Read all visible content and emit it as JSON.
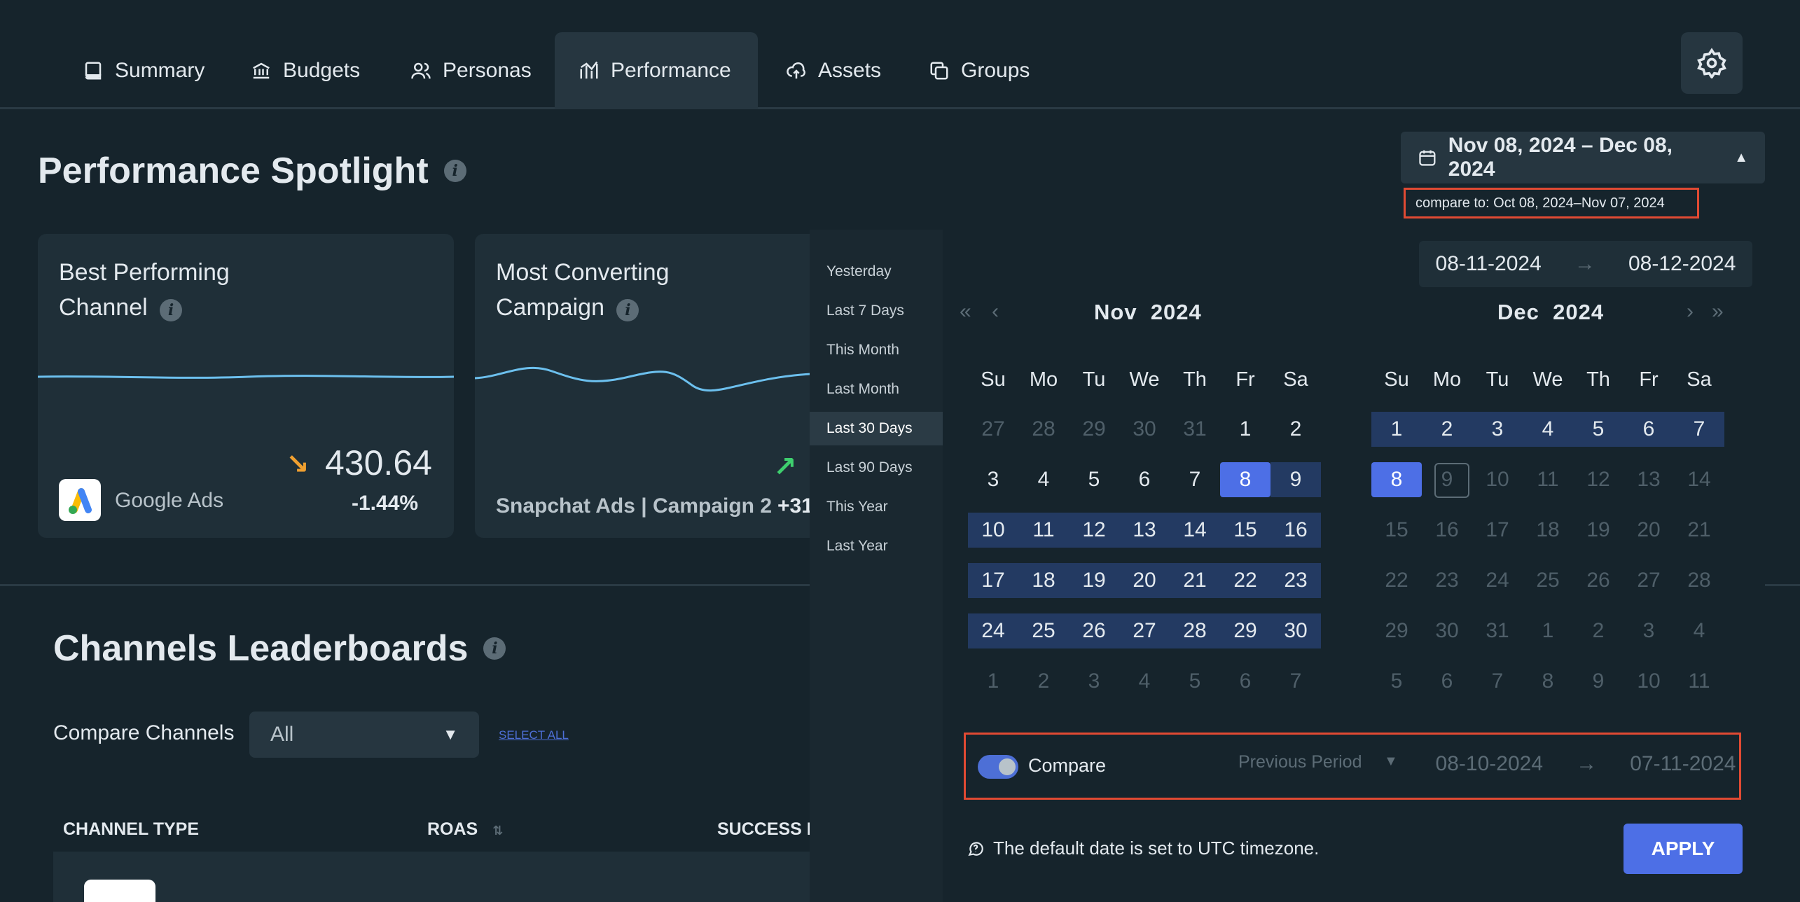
{
  "nav": {
    "tabs": [
      {
        "label": "Summary",
        "icon": "book-icon"
      },
      {
        "label": "Budgets",
        "icon": "bank-icon"
      },
      {
        "label": "Personas",
        "icon": "users-icon"
      },
      {
        "label": "Performance",
        "icon": "chart-icon"
      },
      {
        "label": "Assets",
        "icon": "cloud-upload-icon"
      },
      {
        "label": "Groups",
        "icon": "copy-icon"
      }
    ],
    "active_tab": "Performance",
    "settings_icon": "gear-icon"
  },
  "spotlight": {
    "title": "Performance Spotlight",
    "cards": [
      {
        "title_line1": "Best Performing",
        "title_line2": "Channel",
        "value": "430.64",
        "delta": "-1.44%",
        "channel": "Google Ads",
        "trend": "down"
      },
      {
        "title_line1": "Most Converting",
        "title_line2": "Campaign",
        "value": "",
        "delta": "+31",
        "channel": "Snapchat Ads | Campaign 2",
        "trend": "up"
      }
    ]
  },
  "leaderboards": {
    "title": "Channels Leaderboards",
    "compare_label": "Compare Channels",
    "select_value": "All",
    "select_all": "SELECT ALL",
    "columns": [
      "CHANNEL TYPE",
      "ROAS",
      "SUCCESS M"
    ]
  },
  "date_range": {
    "button_label": "Nov 08, 2024 – Dec 08, 2024",
    "compare_to_label": "compare to:",
    "compare_to_range": "Oct 08, 2024–Nov 07, 2024",
    "presets": [
      "Yesterday",
      "Last 7 Days",
      "This Month",
      "Last Month",
      "Last 30 Days",
      "Last 90 Days",
      "This Year",
      "Last Year"
    ],
    "active_preset": "Last 30 Days",
    "start_input": "08-11-2024",
    "end_input": "08-12-2024",
    "arrow": "→",
    "weekdays": [
      "Su",
      "Mo",
      "Tu",
      "We",
      "Th",
      "Fr",
      "Sa"
    ],
    "left_month": {
      "month": "Nov",
      "year": "2024",
      "days": [
        "27",
        "28",
        "29",
        "30",
        "31",
        "1",
        "2",
        "3",
        "4",
        "5",
        "6",
        "7",
        "8",
        "9",
        "10",
        "11",
        "12",
        "13",
        "14",
        "15",
        "16",
        "17",
        "18",
        "19",
        "20",
        "21",
        "22",
        "23",
        "24",
        "25",
        "26",
        "27",
        "28",
        "29",
        "30",
        "1",
        "2",
        "3",
        "4",
        "5",
        "6",
        "7"
      ]
    },
    "right_month": {
      "month": "Dec",
      "year": "2024",
      "days": [
        "1",
        "2",
        "3",
        "4",
        "5",
        "6",
        "7",
        "8",
        "9",
        "10",
        "11",
        "12",
        "13",
        "14",
        "15",
        "16",
        "17",
        "18",
        "19",
        "20",
        "21",
        "22",
        "23",
        "24",
        "25",
        "26",
        "27",
        "28",
        "29",
        "30",
        "31",
        "1",
        "2",
        "3",
        "4",
        "5",
        "6",
        "7",
        "8",
        "9",
        "10",
        "11"
      ]
    },
    "compare_toggle_label": "Compare",
    "compare_enabled": true,
    "compare_mode": "Previous Period",
    "compare_start": "08-10-2024",
    "compare_end": "07-11-2024",
    "timezone_note": "The default date is set to UTC timezone.",
    "apply_label": "APPLY"
  },
  "colors": {
    "background": "#16242c",
    "accent": "#4d6fe6",
    "range_fill": "#233a62",
    "highlight_border": "#e14a33",
    "positive": "#3ecf6e",
    "negative": "#f0a030"
  }
}
